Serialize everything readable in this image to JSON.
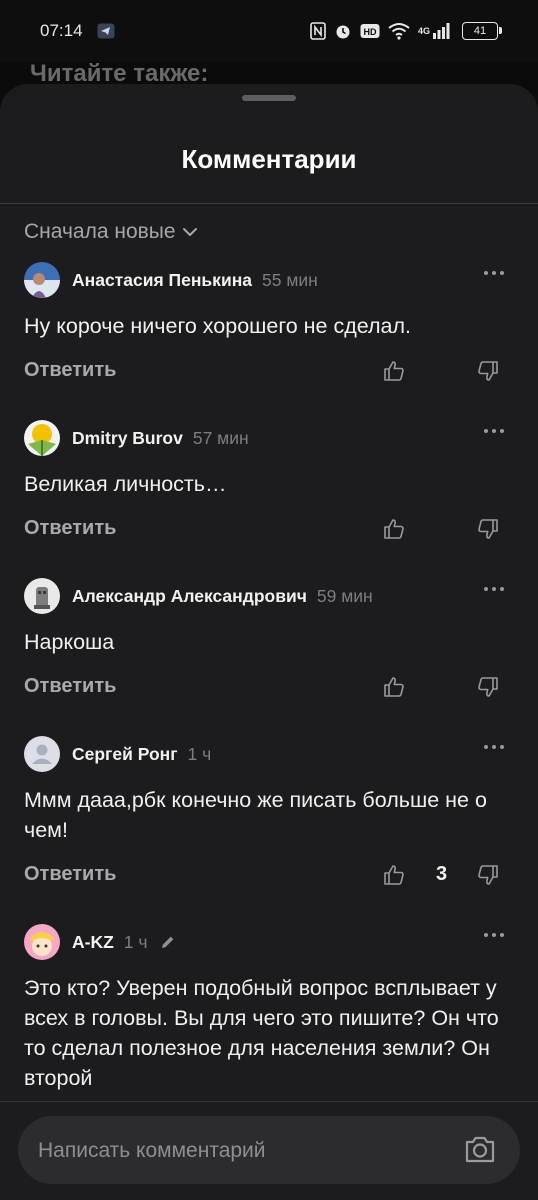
{
  "status_bar": {
    "time": "07:14",
    "network": "4G",
    "battery": "41",
    "icons": [
      "telegram-icon",
      "nfc-icon",
      "alarm-icon",
      "hd-icon",
      "wifi-icon",
      "signal-icon",
      "battery-icon"
    ]
  },
  "background": {
    "partial_heading": "Читайте также:"
  },
  "sheet": {
    "title": "Комментарии",
    "sort_label": "Сначала новые"
  },
  "comments": [
    {
      "author": "Анастасия Пенькина",
      "time": "55 мин",
      "text": "Ну короче ничего хорошего не сделал.",
      "reply_label": "Ответить",
      "likes": "",
      "avatar": "photo-avatar"
    },
    {
      "author": "Dmitry Burov",
      "time": "57 мин",
      "text": "Великая личность…",
      "reply_label": "Ответить",
      "likes": "",
      "avatar": "flower-avatar"
    },
    {
      "author": "Александр Александрович",
      "time": "59 мин",
      "text": "Наркоша",
      "reply_label": "Ответить",
      "likes": "",
      "avatar": "statue-avatar"
    },
    {
      "author": "Сергей Ронг",
      "time": "1 ч",
      "text": "Ммм дааа,рбк конечно же писать больше не о чем!",
      "reply_label": "Ответить",
      "likes": "3",
      "avatar": "default-user-avatar"
    },
    {
      "author": "A-KZ",
      "time": "1 ч",
      "edited": true,
      "text": "Это кто? Уверен подобный вопрос всплывает у всех в головы. Вы для чего это пишите? Он что то сделал полезное для населения земли? Он второй",
      "reply_label": "Ответить",
      "likes": "",
      "avatar": "cartoon-avatar"
    }
  ],
  "composer": {
    "placeholder": "Написать комментарий"
  },
  "colors": {
    "sheet_bg": "#1c1c1e",
    "input_bg": "#2c2c2e",
    "muted_text": "#a7a7ab"
  }
}
